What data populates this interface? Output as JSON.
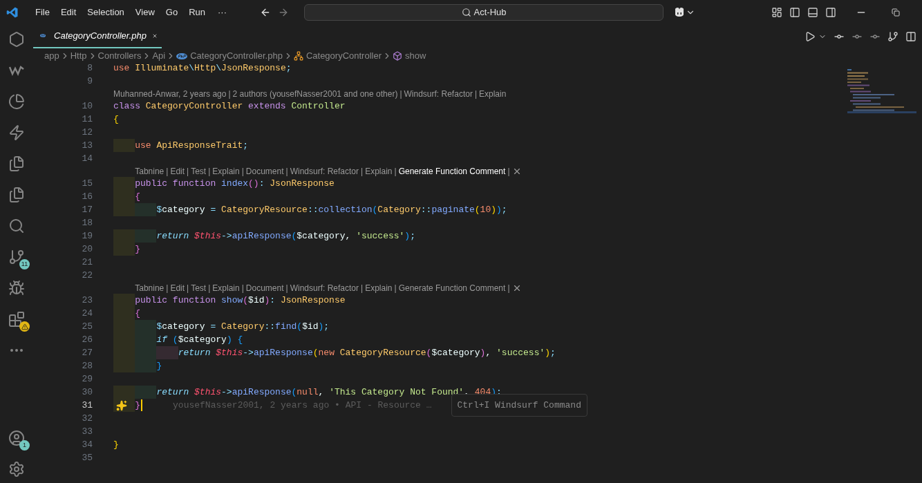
{
  "title_bar": {
    "menus": [
      "File",
      "Edit",
      "Selection",
      "View",
      "Go",
      "Run"
    ],
    "more": "···",
    "search": "Act-Hub"
  },
  "activity_bar": [
    {
      "kind": "windsurf"
    },
    {
      "kind": "logo_w"
    },
    {
      "kind": "pie"
    },
    {
      "kind": "bolt"
    },
    {
      "kind": "files"
    },
    {
      "kind": "files"
    },
    {
      "kind": "search"
    },
    {
      "kind": "source_control",
      "badge": "11"
    },
    {
      "kind": "run_debug"
    },
    {
      "kind": "extensions",
      "alert": true
    },
    {
      "kind": "more"
    },
    {
      "kind": "spacer"
    },
    {
      "kind": "account",
      "badge": "1"
    },
    {
      "kind": "settings"
    }
  ],
  "tabs": [
    {
      "label": "CategoryController.php",
      "selected": true
    }
  ],
  "breadcrumbs": [
    {
      "label": "app",
      "kind": "folder"
    },
    {
      "label": "Http",
      "kind": "folder"
    },
    {
      "label": "Controllers",
      "kind": "folder"
    },
    {
      "label": "Api",
      "kind": "folder"
    },
    {
      "label": "CategoryController.php",
      "kind": "php"
    },
    {
      "label": "CategoryController",
      "kind": "class"
    },
    {
      "label": "show",
      "kind": "method"
    }
  ],
  "lines": [
    {
      "kind": "code",
      "number": "8",
      "cursor": false,
      "tokens": [
        {
          "t": "use ",
          "kind": "use"
        },
        {
          "t": "Illuminate",
          "kind": "type"
        },
        {
          "t": "\\",
          "kind": "op"
        },
        {
          "t": "Http",
          "kind": "type"
        },
        {
          "t": "\\",
          "kind": "op"
        },
        {
          "t": "JsonResponse",
          "kind": "type"
        },
        {
          "t": ";",
          "kind": "op"
        }
      ]
    },
    {
      "kind": "code",
      "number": "9",
      "cursor": false
    },
    {
      "kind": "lens",
      "indented": false,
      "separator": "|",
      "items": [
        {
          "label": "Muhanned-Anwar, 2 years ago",
          "hovered": false
        },
        {
          "label": "2 authors (yousefNasser2001 and one other)",
          "hovered": false
        },
        {
          "label": "Windsurf: Refactor",
          "hovered": false
        },
        {
          "label": "Explain",
          "hovered": false
        }
      ],
      "closable": false
    },
    {
      "kind": "code",
      "number": "10",
      "cursor": false,
      "tokens": [
        {
          "t": "class ",
          "kind": "kw"
        },
        {
          "t": "CategoryController ",
          "kind": "type"
        },
        {
          "t": "extends ",
          "kind": "kw"
        },
        {
          "t": "Controller",
          "kind": "cls"
        }
      ]
    },
    {
      "kind": "code",
      "number": "11",
      "cursor": false,
      "tokens": [
        {
          "t": "{",
          "kind": "b1"
        }
      ]
    },
    {
      "kind": "code",
      "number": "12",
      "cursor": false
    },
    {
      "kind": "code",
      "number": "13",
      "cursor": false,
      "tokens": [
        {
          "t": "    use ",
          "kind": "use"
        },
        {
          "t": "ApiResponseTrait",
          "kind": "type"
        },
        {
          "t": ";",
          "kind": "op"
        }
      ]
    },
    {
      "kind": "code",
      "number": "14",
      "cursor": false
    },
    {
      "kind": "lens",
      "indented": true,
      "separator": "|",
      "items": [
        {
          "label": "Tabnine",
          "hovered": false
        },
        {
          "label": "Edit",
          "hovered": false
        },
        {
          "label": "Test",
          "hovered": false
        },
        {
          "label": "Explain",
          "hovered": false
        },
        {
          "label": "Document",
          "hovered": false
        },
        {
          "label": "Windsurf: Refactor",
          "hovered": false
        },
        {
          "label": "Explain",
          "hovered": false
        },
        {
          "label": "Generate Function Comment",
          "hovered": true
        }
      ],
      "closable": true
    },
    {
      "kind": "code",
      "number": "15",
      "cursor": false,
      "tokens": [
        {
          "t": "    public function ",
          "kind": "kw"
        },
        {
          "t": "index",
          "kind": "fn"
        },
        {
          "t": "()",
          "kind": "b2"
        },
        {
          "t": ": ",
          "kind": "op"
        },
        {
          "t": "JsonResponse",
          "kind": "type"
        }
      ]
    },
    {
      "kind": "code",
      "number": "16",
      "cursor": false,
      "tokens": [
        {
          "t": "    {",
          "kind": "b2"
        }
      ]
    },
    {
      "kind": "code",
      "number": "17",
      "cursor": false,
      "tokens": [
        {
          "t": "        $",
          "kind": "op"
        },
        {
          "t": "category ",
          "kind": "var"
        },
        {
          "t": "= ",
          "kind": "op"
        },
        {
          "t": "CategoryResource",
          "kind": "type"
        },
        {
          "t": "::",
          "kind": "op"
        },
        {
          "t": "collection",
          "kind": "fn"
        },
        {
          "t": "(",
          "kind": "b3"
        },
        {
          "t": "Category",
          "kind": "type"
        },
        {
          "t": "::",
          "kind": "op"
        },
        {
          "t": "paginate",
          "kind": "fn"
        },
        {
          "t": "(",
          "kind": "b1"
        },
        {
          "t": "10",
          "kind": "num"
        },
        {
          "t": ")",
          "kind": "b1"
        },
        {
          "t": ")",
          "kind": "b3"
        },
        {
          "t": ";",
          "kind": "op"
        }
      ]
    },
    {
      "kind": "code",
      "number": "18",
      "cursor": false
    },
    {
      "kind": "code",
      "number": "19",
      "cursor": false,
      "tokens": [
        {
          "t": "        return ",
          "kind": "ret"
        },
        {
          "t": "$this",
          "kind": "this"
        },
        {
          "t": "->",
          "kind": "op"
        },
        {
          "t": "apiResponse",
          "kind": "fn"
        },
        {
          "t": "(",
          "kind": "b3"
        },
        {
          "t": "$category",
          "kind": "var"
        },
        {
          "t": ", ",
          "kind": "var"
        },
        {
          "t": "'success'",
          "kind": "str"
        },
        {
          "t": ")",
          "kind": "b3"
        },
        {
          "t": ";",
          "kind": "op"
        }
      ]
    },
    {
      "kind": "code",
      "number": "20",
      "cursor": false,
      "tokens": [
        {
          "t": "    }",
          "kind": "b2"
        }
      ]
    },
    {
      "kind": "code",
      "number": "21",
      "cursor": false
    },
    {
      "kind": "code",
      "number": "22",
      "cursor": false
    },
    {
      "kind": "lens",
      "indented": true,
      "separator": "|",
      "items": [
        {
          "label": "Tabnine",
          "hovered": false
        },
        {
          "label": "Edit",
          "hovered": false
        },
        {
          "label": "Test",
          "hovered": false
        },
        {
          "label": "Explain",
          "hovered": false
        },
        {
          "label": "Document",
          "hovered": false
        },
        {
          "label": "Windsurf: Refactor",
          "hovered": false
        },
        {
          "label": "Explain",
          "hovered": false
        },
        {
          "label": "Generate Function Comment",
          "hovered": false
        }
      ],
      "closable": true
    },
    {
      "kind": "code",
      "number": "23",
      "cursor": false,
      "tokens": [
        {
          "t": "    public function ",
          "kind": "kw"
        },
        {
          "t": "show",
          "kind": "fn"
        },
        {
          "t": "(",
          "kind": "b2"
        },
        {
          "t": "$id",
          "kind": "var"
        },
        {
          "t": ")",
          "kind": "b2"
        },
        {
          "t": ": ",
          "kind": "op"
        },
        {
          "t": "JsonResponse",
          "kind": "type"
        }
      ]
    },
    {
      "kind": "code",
      "number": "24",
      "cursor": false,
      "tokens": [
        {
          "t": "    {",
          "kind": "b2"
        }
      ]
    },
    {
      "kind": "code",
      "number": "25",
      "cursor": false,
      "tokens": [
        {
          "t": "        $",
          "kind": "op"
        },
        {
          "t": "category ",
          "kind": "var"
        },
        {
          "t": "= ",
          "kind": "op"
        },
        {
          "t": "Category",
          "kind": "type"
        },
        {
          "t": "::",
          "kind": "op"
        },
        {
          "t": "find",
          "kind": "fn"
        },
        {
          "t": "(",
          "kind": "b3"
        },
        {
          "t": "$id",
          "kind": "var"
        },
        {
          "t": ")",
          "kind": "b3"
        },
        {
          "t": ";",
          "kind": "op"
        }
      ]
    },
    {
      "kind": "code",
      "number": "26",
      "cursor": false,
      "tokens": [
        {
          "t": "        if ",
          "kind": "ret"
        },
        {
          "t": "(",
          "kind": "b3"
        },
        {
          "t": "$category",
          "kind": "var"
        },
        {
          "t": ") ",
          "kind": "b3"
        },
        {
          "t": "{",
          "kind": "b3"
        }
      ]
    },
    {
      "kind": "code",
      "number": "27",
      "cursor": false,
      "tokens": [
        {
          "t": "            return ",
          "kind": "ret"
        },
        {
          "t": "$this",
          "kind": "this"
        },
        {
          "t": "->",
          "kind": "op"
        },
        {
          "t": "apiResponse",
          "kind": "fn"
        },
        {
          "t": "(",
          "kind": "b1"
        },
        {
          "t": "new ",
          "kind": "use"
        },
        {
          "t": "CategoryResource",
          "kind": "type"
        },
        {
          "t": "(",
          "kind": "b2"
        },
        {
          "t": "$category",
          "kind": "var"
        },
        {
          "t": ")",
          "kind": "b2"
        },
        {
          "t": ", ",
          "kind": "var"
        },
        {
          "t": "'success'",
          "kind": "str"
        },
        {
          "t": ")",
          "kind": "b1"
        },
        {
          "t": ";",
          "kind": "op"
        }
      ]
    },
    {
      "kind": "code",
      "number": "28",
      "cursor": false,
      "tokens": [
        {
          "t": "        }",
          "kind": "b3"
        }
      ]
    },
    {
      "kind": "code",
      "number": "29",
      "cursor": false
    },
    {
      "kind": "code",
      "number": "30",
      "cursor": false,
      "tokens": [
        {
          "t": "        return ",
          "kind": "ret"
        },
        {
          "t": "$this",
          "kind": "this"
        },
        {
          "t": "->",
          "kind": "op"
        },
        {
          "t": "apiResponse",
          "kind": "fn"
        },
        {
          "t": "(",
          "kind": "b3"
        },
        {
          "t": "null",
          "kind": "use"
        },
        {
          "t": ", ",
          "kind": "var"
        },
        {
          "t": "'This Category Not Found'",
          "kind": "str"
        },
        {
          "t": ", ",
          "kind": "var"
        },
        {
          "t": "404",
          "kind": "num"
        },
        {
          "t": ")",
          "kind": "b3"
        },
        {
          "t": ";",
          "kind": "op"
        }
      ]
    },
    {
      "kind": "code",
      "number": "31",
      "cursor": true,
      "tokens": [
        {
          "t": "    }",
          "kind": "b2"
        }
      ],
      "blame": "yousefNasser2001, 2 years ago • API - Resource …",
      "tooltip": "Ctrl+I Windsurf Command"
    },
    {
      "kind": "code",
      "number": "32",
      "cursor": false
    },
    {
      "kind": "code",
      "number": "33",
      "cursor": false
    },
    {
      "kind": "code",
      "number": "34",
      "cursor": false,
      "tokens": [
        {
          "t": "}",
          "kind": "b1"
        }
      ]
    },
    {
      "kind": "code",
      "number": "35",
      "cursor": false
    }
  ]
}
